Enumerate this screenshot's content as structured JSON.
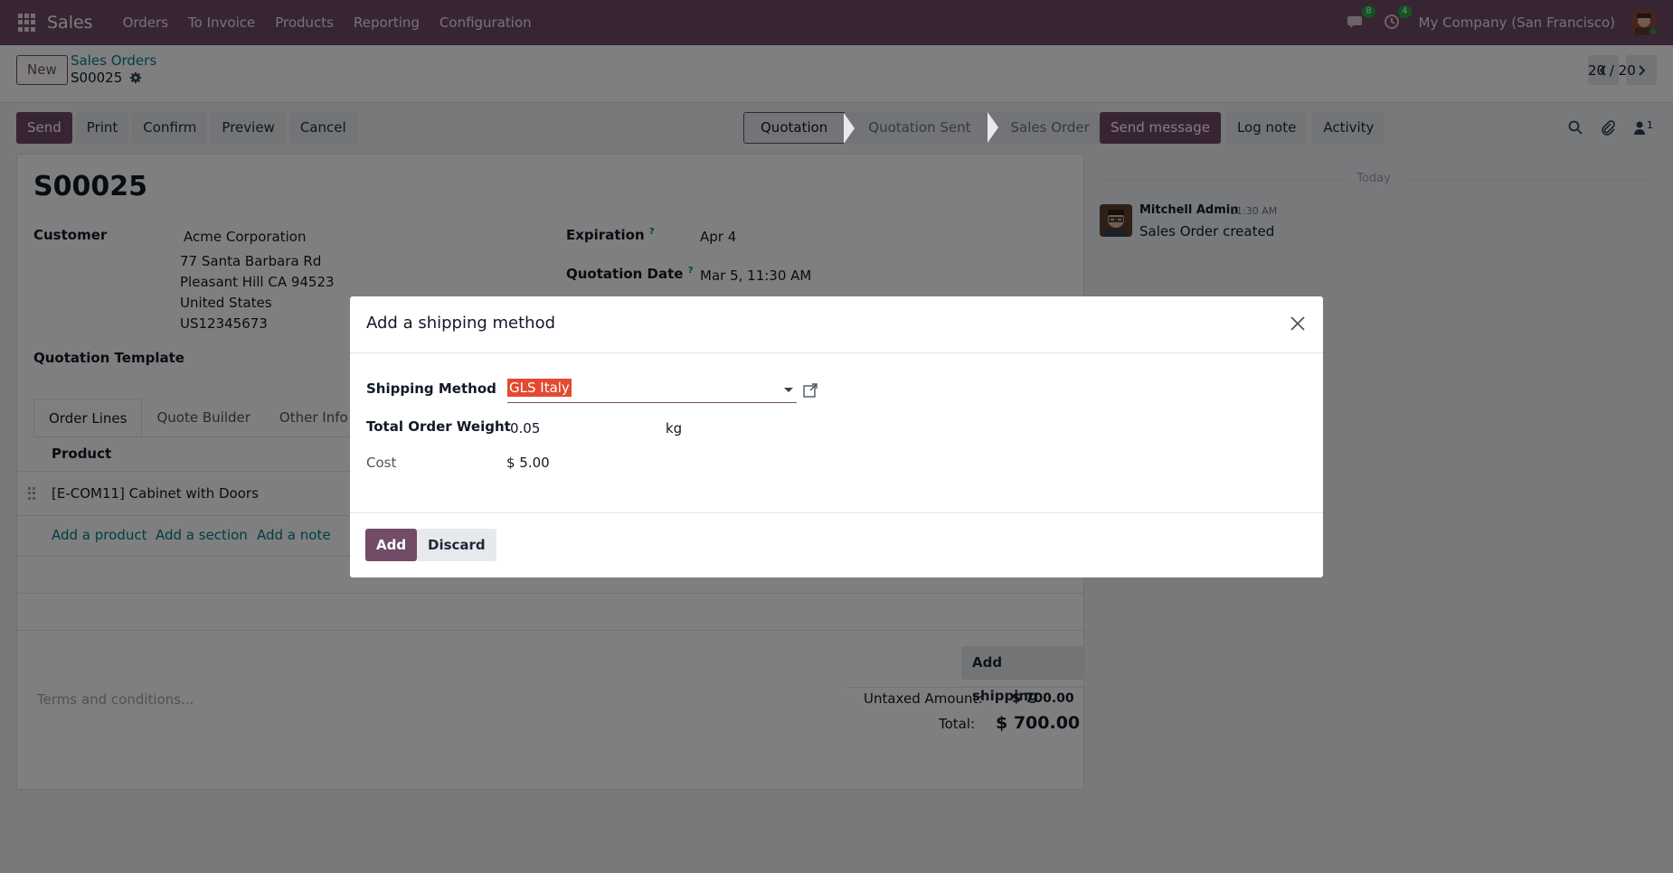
{
  "navbar": {
    "brand": "Sales",
    "menu": [
      "Orders",
      "To Invoice",
      "Products",
      "Reporting",
      "Configuration"
    ],
    "messages_badge": "8",
    "activities_badge": "4",
    "company": "My Company (San Francisco)"
  },
  "control": {
    "new_label": "New",
    "breadcrumb_parent": "Sales Orders",
    "breadcrumb_current": "S00025",
    "pager": "20 / 20"
  },
  "actions": [
    "Send",
    "Print",
    "Confirm",
    "Preview",
    "Cancel"
  ],
  "status_stages": [
    "Quotation",
    "Quotation Sent",
    "Sales Order"
  ],
  "form": {
    "title": "S00025",
    "customer_label": "Customer",
    "customer_name": "Acme Corporation",
    "address_lines": [
      "77 Santa Barbara Rd",
      "Pleasant Hill CA 94523",
      "United States",
      "US12345673"
    ],
    "template_label": "Quotation Template",
    "expiration_label": "Expiration",
    "expiration_value": "Apr 4",
    "quotation_date_label": "Quotation Date",
    "quotation_date_value": "Mar 5, 11:30 AM",
    "help_mark": "?",
    "tabs": [
      "Order Lines",
      "Quote Builder",
      "Other Info"
    ],
    "column_product": "Product",
    "line_product": "[E-COM11] Cabinet with Doors",
    "add_product": "Add a product",
    "add_section": "Add a section",
    "add_note": "Add a note",
    "add_shipping": "Add shipping",
    "terms_placeholder": "Terms and conditions...",
    "untaxed_label": "Untaxed Amount:",
    "untaxed_value": "$ 700.00",
    "total_label": "Total:",
    "total_value": "$ 700.00"
  },
  "chatter": {
    "send_message": "Send message",
    "log_note": "Log note",
    "activity": "Activity",
    "followers_count": "1",
    "today": "Today",
    "author": "Mitchell Admin",
    "time": "11:30 AM",
    "body": "Sales Order created"
  },
  "modal": {
    "title": "Add a shipping method",
    "shipping_method_label": "Shipping Method",
    "shipping_method_value": "GLS Italy",
    "weight_label": "Total Order Weight",
    "weight_value": "0.05",
    "weight_unit": "kg",
    "cost_label": "Cost",
    "cost_value": "$ 5.00",
    "add_button": "Add",
    "discard_button": "Discard"
  },
  "colors": {
    "brand": "#714b67",
    "link": "#017e84",
    "highlight": "#e24a31"
  }
}
